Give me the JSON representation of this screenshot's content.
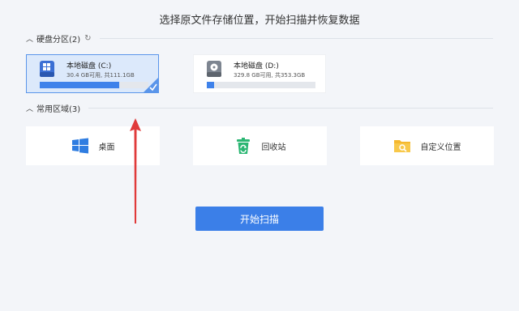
{
  "title": "选择原文件存储位置，开始扫描并恢复数据",
  "disk_section": {
    "label": "硬盘分区(2)",
    "collapse_icon": "chevron-up-icon",
    "refresh_icon": "refresh-icon"
  },
  "drives": [
    {
      "name": "本地磁盘 (C:)",
      "info": "30.4 GB可用, 共111.1GB",
      "used_fraction": 0.73,
      "selected": true
    },
    {
      "name": "本地磁盘 (D:)",
      "info": "329.8 GB可用, 共353.3GB",
      "used_fraction": 0.07,
      "selected": false
    }
  ],
  "common_section": {
    "label": "常用区域(3)",
    "collapse_icon": "chevron-up-icon"
  },
  "areas": [
    {
      "label": "桌面",
      "icon": "windows-icon"
    },
    {
      "label": "回收站",
      "icon": "recycle-bin-icon"
    },
    {
      "label": "自定义位置",
      "icon": "folder-search-icon"
    }
  ],
  "scan_button": {
    "label": "开始扫描"
  },
  "colors": {
    "accent": "#3b7fe8",
    "arrow": "#e03a3a",
    "recycle": "#2bb673",
    "folder": "#f5b82e"
  }
}
